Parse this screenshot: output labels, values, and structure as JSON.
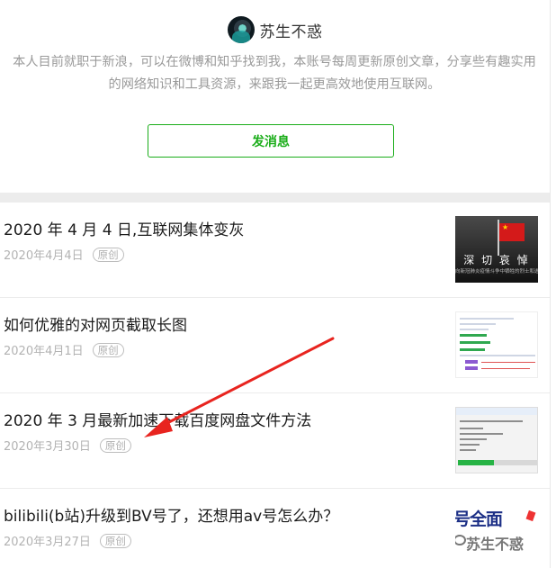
{
  "profile": {
    "name": "苏生不惑",
    "description": "本人目前就职于新浪，可以在微博和知乎找到我，本账号每周更新原创文章，分享些有趣实用的网络知识和工具资源，来跟我一起更高效地使用互联网。",
    "message_button": "发消息"
  },
  "articles": [
    {
      "title": "2020 年 4 月 4 日,互联网集体变灰",
      "date": "2020年4月4日",
      "tag": "原创",
      "thumb": {
        "caption": "深 切 哀 悼",
        "subcaption": "向新冠肺炎疫情斗争中牺牲的烈士和逝世同胞"
      }
    },
    {
      "title": "如何优雅的对网页截取长图",
      "date": "2020年4月1日",
      "tag": "原创"
    },
    {
      "title": "2020 年 3 月最新加速下载百度网盘文件方法",
      "date": "2020年3月30日",
      "tag": "原创"
    },
    {
      "title": "bilibili(b站)升级到BV号了，还想用av号怎么办？",
      "date": "2020年3月27日",
      "tag": "原创",
      "thumb": {
        "headline": "号全面",
        "watermark": "苏生不惑"
      }
    }
  ],
  "colors": {
    "accent_green": "#1aad19",
    "annotation_red": "#e8241f",
    "meta_gray": "#b3b3b3"
  }
}
